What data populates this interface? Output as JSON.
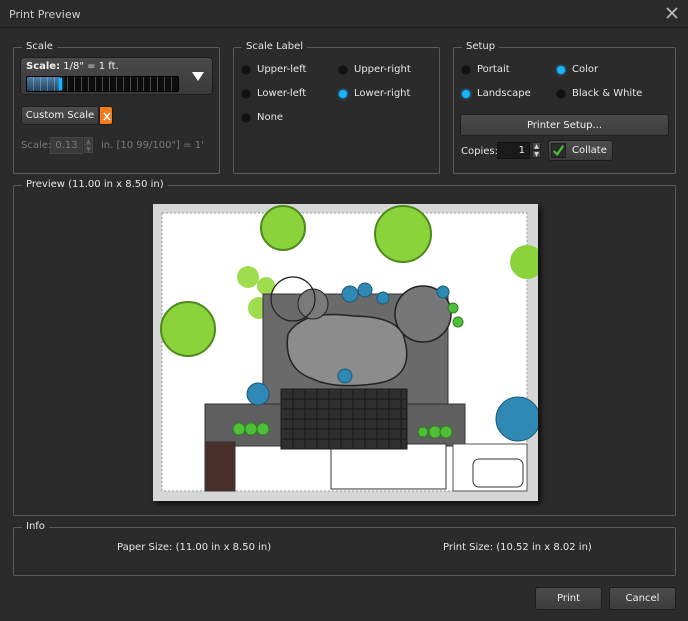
{
  "window": {
    "title": "Print Preview"
  },
  "scale": {
    "legend": "Scale",
    "label_key": "Scale:",
    "label_value": "1/8\" = 1 ft.",
    "slider_fraction": 0.22,
    "custom_scale_label": "Custom Scale",
    "custom_field_label": "Scale:",
    "custom_field_value": "0.13",
    "custom_field_suffix": "in. [10 99/100\"] = 1'"
  },
  "scale_label": {
    "legend": "Scale Label",
    "options": [
      {
        "label": "Upper-left",
        "selected": false
      },
      {
        "label": "Upper-right",
        "selected": false
      },
      {
        "label": "Lower-left",
        "selected": false
      },
      {
        "label": "Lower-right",
        "selected": true
      },
      {
        "label": "None",
        "selected": false
      }
    ]
  },
  "setup": {
    "legend": "Setup",
    "orientation": [
      {
        "label": "Portait",
        "selected": false
      },
      {
        "label": "Landscape",
        "selected": true
      }
    ],
    "color_mode": [
      {
        "label": "Color",
        "selected": true
      },
      {
        "label": "Black & White",
        "selected": false
      }
    ],
    "printer_setup_label": "Printer Setup...",
    "copies_label": "Copies:",
    "copies_value": "1",
    "collate_label": "Collate",
    "collate_checked": true
  },
  "preview": {
    "legend": "Preview (11.00 in x 8.50 in)"
  },
  "info": {
    "legend": "Info",
    "paper_size": "Paper Size: (11.00 in x 8.50 in)",
    "print_size": "Print Size: (10.52 in x 8.02 in)"
  },
  "footer": {
    "print_label": "Print",
    "cancel_label": "Cancel"
  },
  "colors": {
    "accent": "#19b4ff",
    "background": "#2b2b2b",
    "custom_scale_x": "#f07c1e",
    "collate_check": "#4cc33a"
  }
}
